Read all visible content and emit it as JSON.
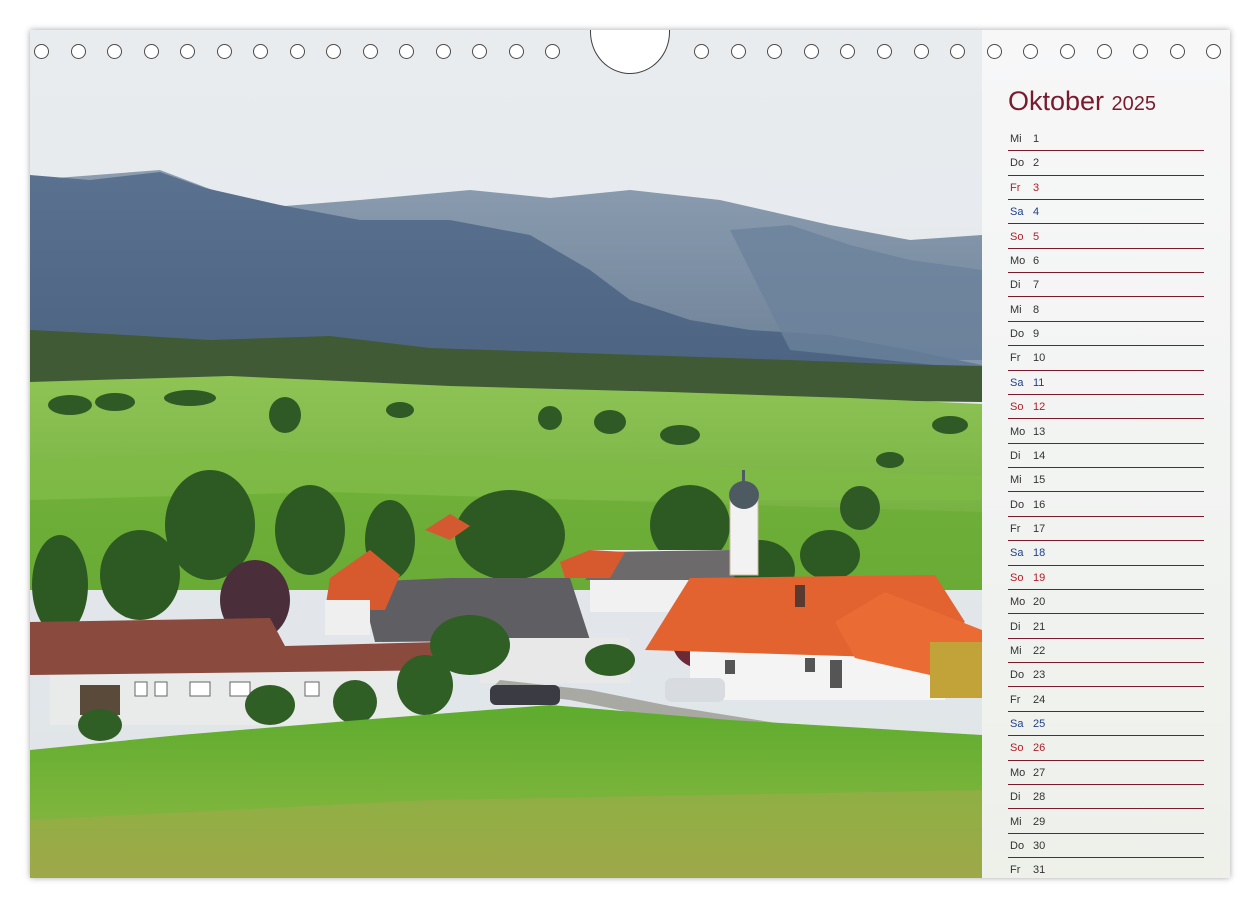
{
  "calendar": {
    "month": "Oktober",
    "year": "2025",
    "colors": {
      "accent": "#7a1a2c",
      "saturday": "#1f3f8a",
      "sunday": "#b0202a"
    },
    "days": [
      {
        "wd": "Mi",
        "num": "1",
        "type": "weekday"
      },
      {
        "wd": "Do",
        "num": "2",
        "type": "weekday"
      },
      {
        "wd": "Fr",
        "num": "3",
        "type": "sun"
      },
      {
        "wd": "Sa",
        "num": "4",
        "type": "sat"
      },
      {
        "wd": "So",
        "num": "5",
        "type": "sun"
      },
      {
        "wd": "Mo",
        "num": "6",
        "type": "weekday"
      },
      {
        "wd": "Di",
        "num": "7",
        "type": "weekday"
      },
      {
        "wd": "Mi",
        "num": "8",
        "type": "weekday"
      },
      {
        "wd": "Do",
        "num": "9",
        "type": "weekday"
      },
      {
        "wd": "Fr",
        "num": "10",
        "type": "weekday"
      },
      {
        "wd": "Sa",
        "num": "11",
        "type": "sat"
      },
      {
        "wd": "So",
        "num": "12",
        "type": "sun"
      },
      {
        "wd": "Mo",
        "num": "13",
        "type": "weekday"
      },
      {
        "wd": "Di",
        "num": "14",
        "type": "weekday"
      },
      {
        "wd": "Mi",
        "num": "15",
        "type": "weekday"
      },
      {
        "wd": "Do",
        "num": "16",
        "type": "weekday"
      },
      {
        "wd": "Fr",
        "num": "17",
        "type": "weekday"
      },
      {
        "wd": "Sa",
        "num": "18",
        "type": "sat"
      },
      {
        "wd": "So",
        "num": "19",
        "type": "sun"
      },
      {
        "wd": "Mo",
        "num": "20",
        "type": "weekday"
      },
      {
        "wd": "Di",
        "num": "21",
        "type": "weekday"
      },
      {
        "wd": "Mi",
        "num": "22",
        "type": "weekday"
      },
      {
        "wd": "Do",
        "num": "23",
        "type": "weekday"
      },
      {
        "wd": "Fr",
        "num": "24",
        "type": "weekday"
      },
      {
        "wd": "Sa",
        "num": "25",
        "type": "sat"
      },
      {
        "wd": "So",
        "num": "26",
        "type": "sun"
      },
      {
        "wd": "Mo",
        "num": "27",
        "type": "weekday"
      },
      {
        "wd": "Di",
        "num": "28",
        "type": "weekday"
      },
      {
        "wd": "Mi",
        "num": "29",
        "type": "weekday"
      },
      {
        "wd": "Do",
        "num": "30",
        "type": "weekday"
      },
      {
        "wd": "Fr",
        "num": "31",
        "type": "weekday"
      }
    ]
  }
}
